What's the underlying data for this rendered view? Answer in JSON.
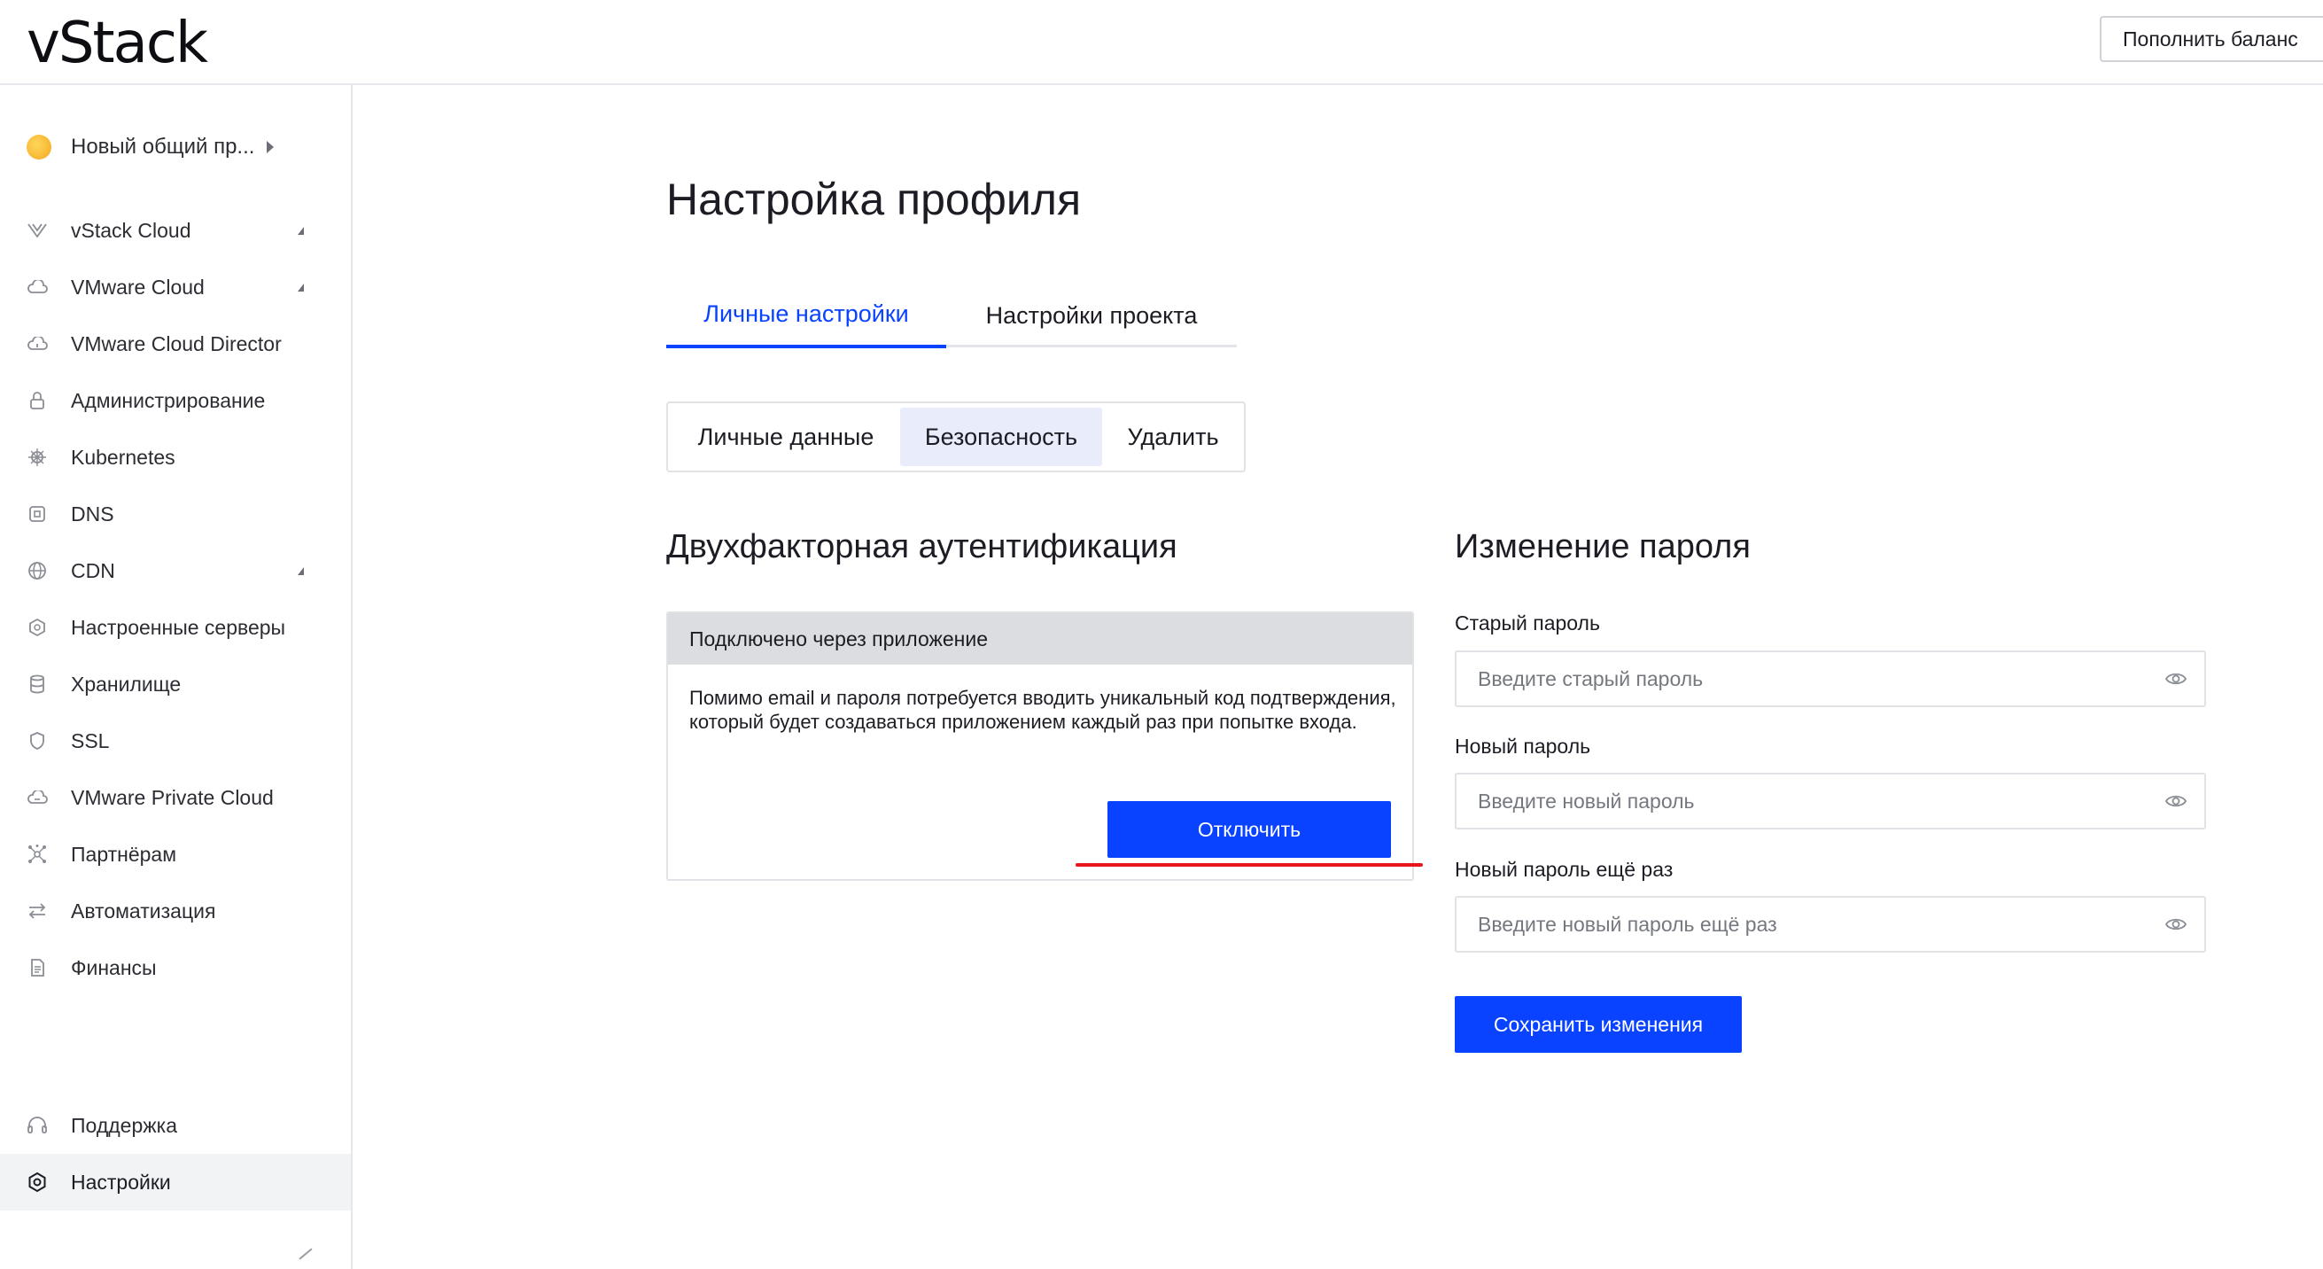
{
  "header": {
    "logo": "vStack",
    "topup_label": "Пополнить баланс"
  },
  "sidebar": {
    "project": "Новый общий пр...",
    "items": [
      {
        "label": "vStack Cloud",
        "icon": "vstack-logo-icon",
        "caret": true
      },
      {
        "label": "VMware Cloud",
        "icon": "cloud-icon",
        "caret": true
      },
      {
        "label": "VMware Cloud Director",
        "icon": "cloud-director-icon",
        "caret": false
      },
      {
        "label": "Администрирование",
        "icon": "lock-icon",
        "caret": false
      },
      {
        "label": "Kubernetes",
        "icon": "helm-icon",
        "caret": false
      },
      {
        "label": "DNS",
        "icon": "dns-icon",
        "caret": false
      },
      {
        "label": "CDN",
        "icon": "globe-icon",
        "caret": true
      },
      {
        "label": "Настроенные серверы",
        "icon": "server-cube-icon",
        "caret": false
      },
      {
        "label": "Хранилище",
        "icon": "database-icon",
        "caret": false
      },
      {
        "label": "SSL",
        "icon": "shield-icon",
        "caret": false
      },
      {
        "label": "VMware Private Cloud",
        "icon": "private-cloud-icon",
        "caret": false
      },
      {
        "label": "Партнёрам",
        "icon": "partners-icon",
        "caret": false
      },
      {
        "label": "Автоматизация",
        "icon": "arrows-swap-icon",
        "caret": false
      },
      {
        "label": "Финансы",
        "icon": "document-icon",
        "caret": false
      }
    ],
    "bottom_items": [
      {
        "label": "Поддержка",
        "icon": "headset-icon"
      },
      {
        "label": "Настройки",
        "icon": "gear-icon"
      }
    ]
  },
  "main": {
    "title": "Настройка профиля",
    "tabs": [
      {
        "label": "Личные настройки",
        "active": true
      },
      {
        "label": "Настройки проекта",
        "active": false
      }
    ],
    "segments": [
      {
        "label": "Личные данные",
        "active": false
      },
      {
        "label": "Безопасность",
        "active": true
      },
      {
        "label": "Удалить",
        "active": false
      }
    ],
    "two_factor": {
      "title": "Двухфакторная аутентификация",
      "status": "Подключено через приложение",
      "description": "Помимо email и пароля потребуется вводить уникальный код подтверждения, который будет создаваться приложением каждый раз при попытке входа.",
      "disable_label": "Отключить"
    },
    "password": {
      "title": "Изменение пароля",
      "old_label": "Старый пароль",
      "old_placeholder": "Введите старый пароль",
      "new_label": "Новый пароль",
      "new_placeholder": "Введите новый пароль",
      "repeat_label": "Новый пароль ещё раз",
      "repeat_placeholder": "Введите новый пароль ещё раз",
      "save_label": "Сохранить изменения"
    }
  },
  "colors": {
    "accent": "#0a43ff",
    "highlight": "#e8141f",
    "active_segment": "#e8ecfb"
  }
}
